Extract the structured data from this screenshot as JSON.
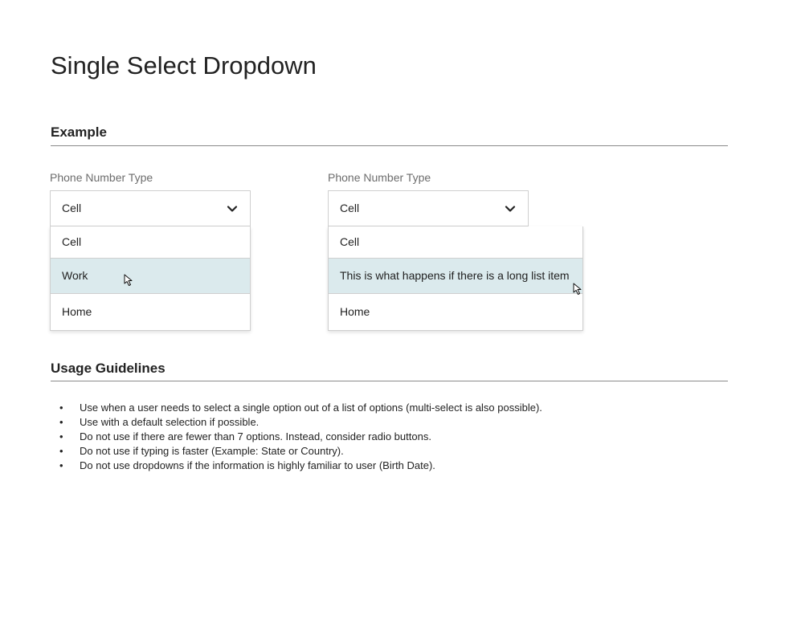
{
  "page": {
    "title": "Single Select Dropdown"
  },
  "example": {
    "heading": "Example",
    "dropdowns": [
      {
        "label": "Phone Number Type",
        "selected": "Cell",
        "options": [
          "Cell",
          "Work",
          "Home"
        ],
        "hovered_option": "Work"
      },
      {
        "label": "Phone Number Type",
        "selected": "Cell",
        "options": [
          "Cell",
          "This is what happens if there is a long list item",
          "Home"
        ],
        "hovered_option": "This is what happens if there is a long list item"
      }
    ]
  },
  "usage": {
    "heading": "Usage Guidelines",
    "bullet_glyph": "•",
    "items": [
      "Use when a user needs to select a single option out of a list of options (multi-select is also possible).",
      "Use with a default selection if possible.",
      "Do not use if there are fewer than 7 options. Instead, consider radio buttons.",
      "Do not use if typing is faster (Example: State or Country).",
      "Do not use dropdowns if the information is highly familiar to user (Birth Date)."
    ]
  },
  "colors": {
    "hover_background": "#dbeaed",
    "border": "#cfcfcf",
    "rule": "#8a8a8a",
    "label": "#6d6d6d",
    "text": "#222222"
  },
  "icons": {
    "dropdown_toggle": "chevron-down-icon",
    "pointer": "mouse-cursor-icon"
  }
}
